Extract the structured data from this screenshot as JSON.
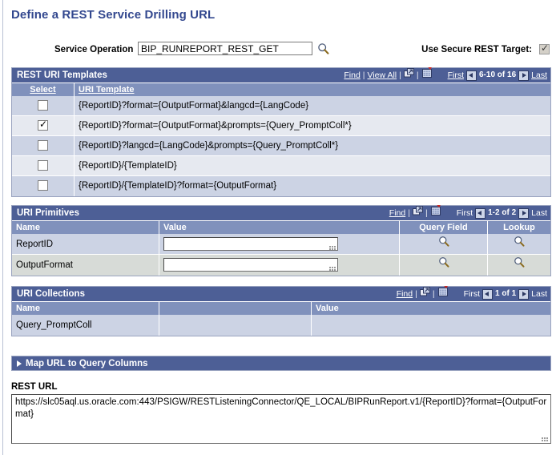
{
  "page": {
    "title": "Define a REST Service Drilling URL"
  },
  "service_operation": {
    "label": "Service Operation",
    "value": "BIP_RUNREPORT_REST_GET",
    "placeholder": "",
    "lookup_icon": "magnifier-icon"
  },
  "secure_target": {
    "label": "Use Secure REST Target:",
    "checked": true,
    "check_glyph": "✓"
  },
  "uri_templates": {
    "title": "REST URI Templates",
    "tools": {
      "find": "Find",
      "view_all": "View All",
      "separator": "|",
      "popout_icon": "popout-icon",
      "download_icon": "grid-download-icon",
      "first": "First",
      "last": "Last",
      "range": "6-10 of 16",
      "prev_icon": "prev-arrow-icon",
      "next_icon": "next-arrow-icon"
    },
    "columns": [
      "Select",
      "URI Template"
    ],
    "rows": [
      {
        "selected": false,
        "template": "{ReportID}?format={OutputFormat}&langcd={LangCode}"
      },
      {
        "selected": true,
        "template": "{ReportID}?format={OutputFormat}&prompts={Query_PromptColl*}"
      },
      {
        "selected": false,
        "template": "{ReportID}?langcd={LangCode}&prompts={Query_PromptColl*}"
      },
      {
        "selected": false,
        "template": "{ReportID}/{TemplateID}"
      },
      {
        "selected": false,
        "template": "{ReportID}/{TemplateID}?format={OutputFormat}"
      }
    ]
  },
  "uri_primitives": {
    "title": "URI Primitives",
    "tools": {
      "find": "Find",
      "separator": "|",
      "popout_icon": "popout-icon",
      "download_icon": "grid-download-icon",
      "first": "First",
      "last": "Last",
      "range": "1-2 of 2"
    },
    "columns": [
      "Name",
      "Value",
      "Query Field",
      "Lookup"
    ],
    "rows": [
      {
        "name": "ReportID",
        "value": "",
        "query_field_icon": "magnifier-icon",
        "lookup_icon": "magnifier-icon"
      },
      {
        "name": "OutputFormat",
        "value": "",
        "query_field_icon": "magnifier-icon",
        "lookup_icon": "magnifier-icon"
      }
    ]
  },
  "uri_collections": {
    "title": "URI Collections",
    "tools": {
      "find": "Find",
      "separator": "|",
      "popout_icon": "popout-icon",
      "download_icon": "grid-download-icon",
      "first": "First",
      "last": "Last",
      "range": "1 of 1"
    },
    "columns": [
      "Name",
      "",
      "Value"
    ],
    "rows": [
      {
        "name": "Query_PromptColl",
        "middle": "",
        "value": ""
      }
    ]
  },
  "map_url_section": {
    "label": "Map URL to Query Columns",
    "expanded": false,
    "toggle_icon": "collapsed-triangle-icon"
  },
  "rest_url": {
    "label": "REST URL",
    "value": "https://slc05aql.us.oracle.com:443/PSIGW/RESTListeningConnector/QE_LOCAL/BIPRunReport.v1/{ReportID}?format={OutputFormat}"
  },
  "colors": {
    "title_text": "#33488f",
    "grid_header": "#4d5f96",
    "column_header": "#8091bc",
    "row_odd": "#ccd3e4",
    "row_even": "#e6e9f0",
    "page_bg": "#ffffff"
  }
}
